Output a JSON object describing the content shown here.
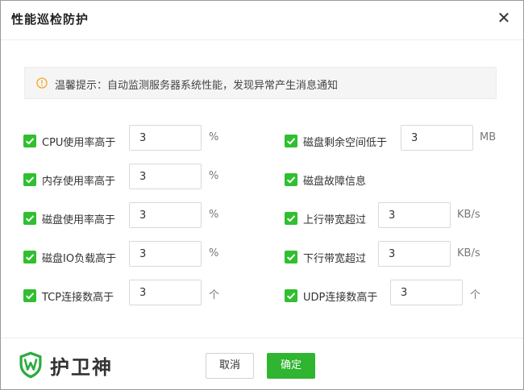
{
  "dialog": {
    "title": "性能巡检防护",
    "close_icon": "close-icon",
    "tip": {
      "icon": "warning-circle-icon",
      "text": "温馨提示：自动监测服务器系统性能，发现异常产生消息通知"
    }
  },
  "settings": {
    "left": [
      {
        "label": "CPU使用率高于",
        "value": "3",
        "unit": "%",
        "checked": true
      },
      {
        "label": "内存使用率高于",
        "value": "3",
        "unit": "%",
        "checked": true
      },
      {
        "label": "磁盘使用率高于",
        "value": "3",
        "unit": "%",
        "checked": true
      },
      {
        "label": "磁盘IO负载高于",
        "value": "3",
        "unit": "%",
        "checked": true
      },
      {
        "label": "TCP连接数高于",
        "value": "3",
        "unit": "个",
        "checked": true
      }
    ],
    "right": [
      {
        "label": "磁盘剩余空间低于",
        "value": "3",
        "unit": "MB",
        "checked": true
      },
      {
        "label": "磁盘故障信息",
        "checked": true
      },
      {
        "label": "上行带宽超过",
        "value": "3",
        "unit": "KB/s",
        "checked": true
      },
      {
        "label": "下行带宽超过",
        "value": "3",
        "unit": "KB/s",
        "checked": true
      },
      {
        "label": "UDP连接数高于",
        "value": "3",
        "unit": "个",
        "checked": true
      }
    ]
  },
  "footer": {
    "logo_icon": "shield-w-logo-icon",
    "logo_text": "护卫神",
    "cancel_label": "取消",
    "ok_label": "确定"
  },
  "colors": {
    "accent_green": "#2fb52f",
    "checkbox_green": "#2fbf2f",
    "warning_orange": "#f5a623",
    "logo_green": "#2daa3f"
  }
}
